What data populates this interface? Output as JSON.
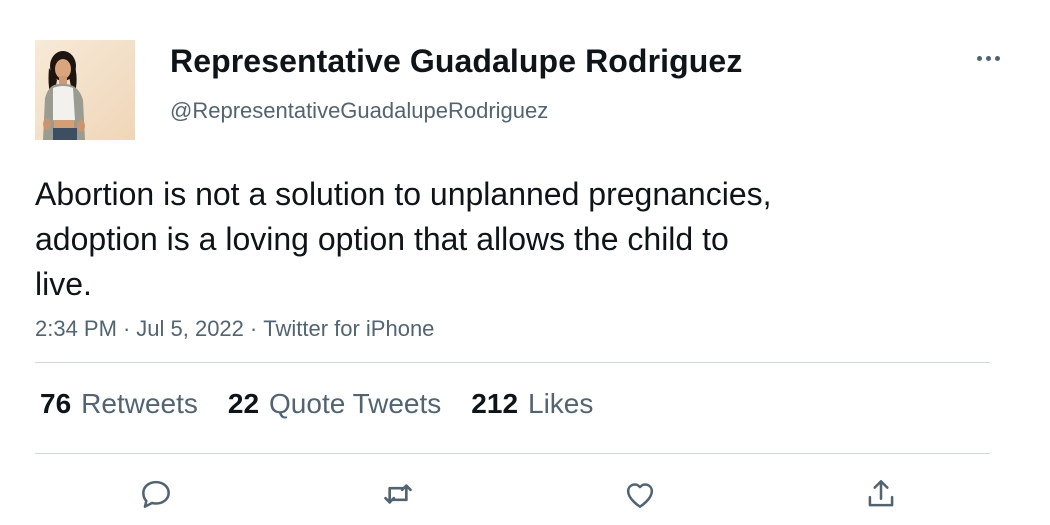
{
  "author": {
    "display_name": "Representative Guadalupe Rodriguez",
    "handle": "@RepresentativeGuadalupeRodriguez",
    "avatar_icon": "profile-photo"
  },
  "tweet": {
    "lines": [
      "Abortion is not a solution to unplanned pregnancies,",
      "adoption is a loving option that allows the child to",
      "live."
    ],
    "time": "2:34 PM",
    "date": "Jul 5, 2022",
    "source": "Twitter for iPhone",
    "separator": "·"
  },
  "stats": {
    "retweets": {
      "count": "76",
      "label": "Retweets"
    },
    "quotes": {
      "count": "22",
      "label": "Quote Tweets"
    },
    "likes": {
      "count": "212",
      "label": "Likes"
    }
  },
  "actions": {
    "icons": [
      "reply-icon",
      "retweet-icon",
      "like-icon",
      "share-icon"
    ],
    "color": "#536471"
  },
  "colors": {
    "text": "#0f1419",
    "secondary": "#536471",
    "divider": "#cfd9de"
  }
}
